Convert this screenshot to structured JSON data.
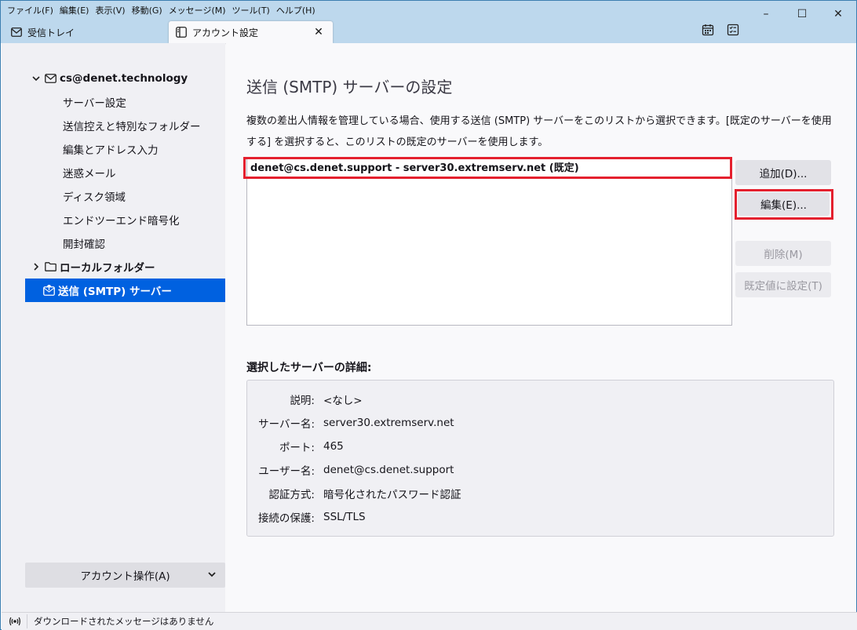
{
  "menu": [
    "ファイル(F)",
    "編集(E)",
    "表示(V)",
    "移動(G)",
    "メッセージ(M)",
    "ツール(T)",
    "ヘルプ(H)"
  ],
  "window_controls": {
    "minimize": "–",
    "maximize": "☐",
    "close": "✕"
  },
  "tabs": {
    "inbox": "受信トレイ",
    "account_settings": "アカウント設定",
    "close": "✕"
  },
  "sidebar": {
    "account": "cs@denet.technology",
    "children": [
      "サーバー設定",
      "送信控えと特別なフォルダー",
      "編集とアドレス入力",
      "迷惑メール",
      "ディスク領域",
      "エンドツーエンド暗号化",
      "開封確認"
    ],
    "local_folders": "ローカルフォルダー",
    "smtp": "送信 (SMTP) サーバー",
    "account_actions": "アカウント操作(A)"
  },
  "main": {
    "title": "送信 (SMTP) サーバーの設定",
    "description": "複数の差出人情報を管理している場合、使用する送信 (SMTP) サーバーをこのリストから選択できます。[既定のサーバーを使用する] を選択すると、このリストの既定のサーバーを使用します。",
    "servers": [
      "denet@cs.denet.support - server30.extremserv.net (既定)"
    ],
    "buttons": {
      "add": "追加(D)...",
      "edit": "編集(E)...",
      "delete": "削除(M)",
      "set_default": "既定値に設定(T)"
    },
    "details_title": "選択したサーバーの詳細:",
    "details": [
      {
        "label": "説明:",
        "value": "<なし>"
      },
      {
        "label": "サーバー名:",
        "value": "server30.extremserv.net"
      },
      {
        "label": "ポート:",
        "value": "465"
      },
      {
        "label": "ユーザー名:",
        "value": "denet@cs.denet.support"
      },
      {
        "label": "認証方式:",
        "value": "暗号化されたパスワード認証"
      },
      {
        "label": "接続の保護:",
        "value": "SSL/TLS"
      }
    ]
  },
  "status": {
    "text": "ダウンロードされたメッセージはありません"
  },
  "colors": {
    "accent": "#0061e0",
    "highlight_box": "#e4202e",
    "chrome": "#bdd8ed"
  }
}
